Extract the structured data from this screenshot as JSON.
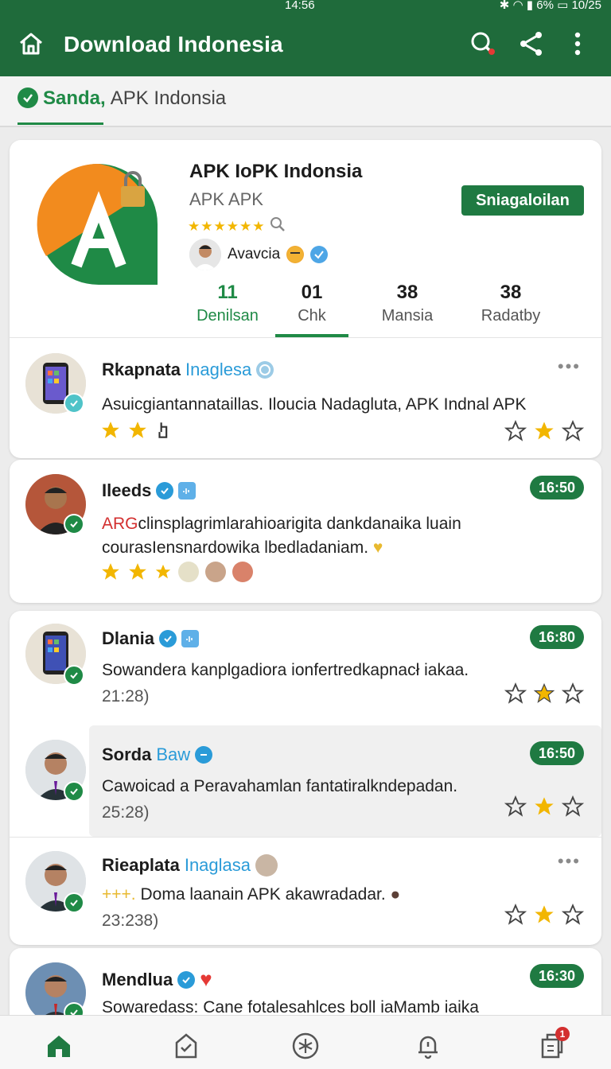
{
  "status_bar": {
    "time": "14:56",
    "battery": "6%",
    "right_time": "10/25"
  },
  "app_bar": {
    "title": "Download Indonesia"
  },
  "tab": {
    "label_a": "Sanda,",
    "label_b": "APK Indonsia"
  },
  "app": {
    "name": "APK IoPK Indonsia",
    "subtitle": "APK APK",
    "stars": "★★★★★★",
    "author": "Avavcia",
    "button": "Sniagaloilan"
  },
  "stats": [
    {
      "value": "11",
      "label": "Denilsan"
    },
    {
      "value": "01",
      "label": "Chk"
    },
    {
      "value": "38",
      "label": "Mansia"
    },
    {
      "value": "38",
      "label": "Radatby"
    }
  ],
  "reviews": [
    {
      "name": "Rkapnata",
      "tag": "Inaglesa",
      "text": "Asuicgiantannataillas. Iloucia Nadagluta, APK Indnal APK"
    },
    {
      "name": "Ileeds",
      "tag": "",
      "time_badge": "16:50",
      "text_prefix": "ARG",
      "text_red": "clinsplagrimlarahioarigita dankdanaika luain",
      "text_line2": "courasIensnardowika lbedladaniam."
    },
    {
      "name": "Dlania",
      "tag": "",
      "time_badge": "16:80",
      "text": "Sowandera kanplgadiora ionfertredkapnacł iakaa.",
      "time": "21:28)"
    },
    {
      "name": "Sorda",
      "tag": "Baw",
      "time_badge": "16:50",
      "text": "Cawoicad a Peravahamlan fantatiralkndepadan.",
      "time": "25:28)"
    },
    {
      "name": "Rieaplata",
      "tag": "Inaglasa",
      "text_prefix": "+++.",
      "text": "Doma laanain APK akawradadar.",
      "time": "23:238)"
    },
    {
      "name": "Mendlua",
      "tag": "",
      "time_badge": "16:30",
      "text": "Sowaredass: Cane fotalesahlces boll iaMamb iaika"
    }
  ],
  "nav": {
    "notification_count": "1"
  },
  "colors": {
    "primary": "#1f6b3b",
    "accent": "#1f8a46",
    "star": "#f2b600",
    "link": "#2a9bd8"
  }
}
